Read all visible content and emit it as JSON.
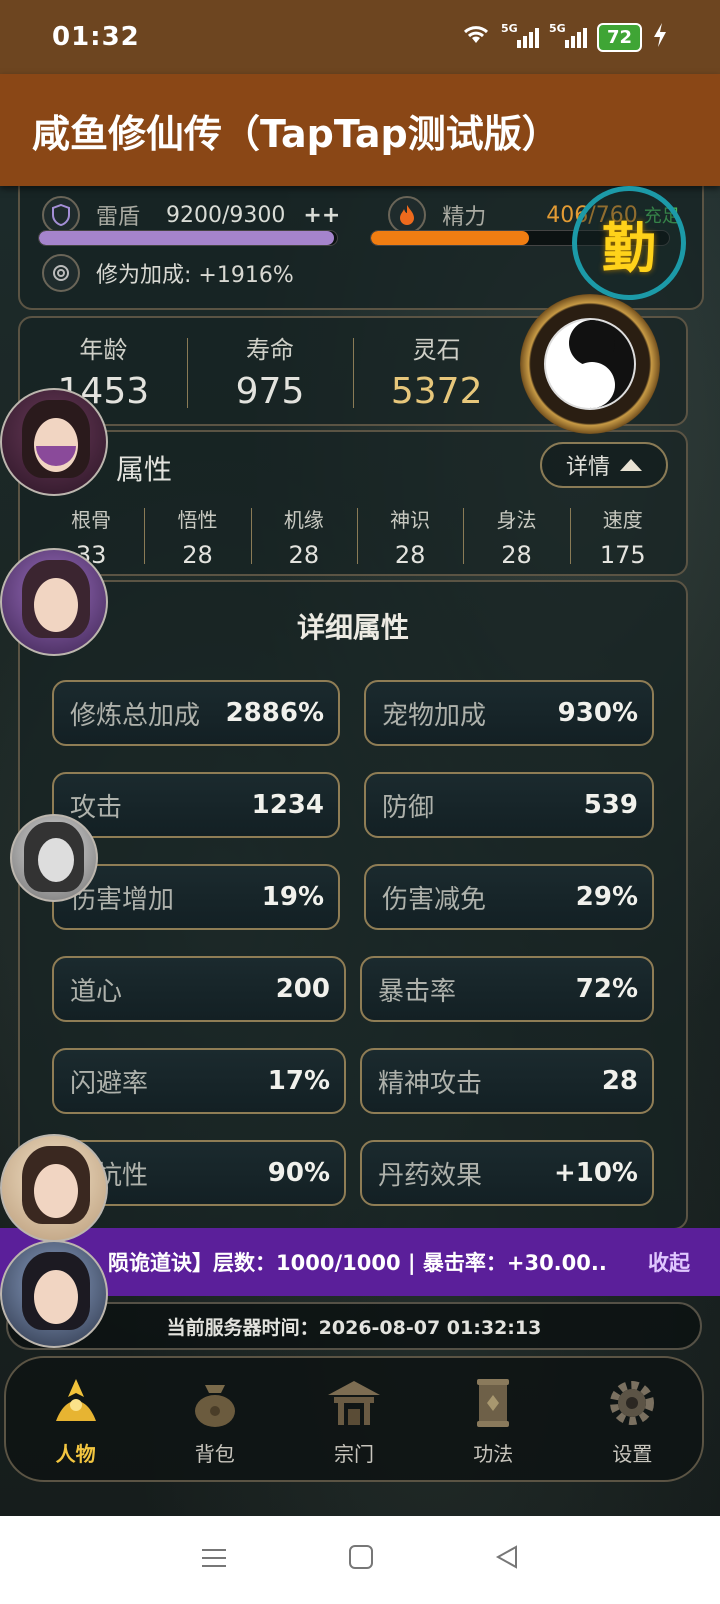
{
  "status_bar": {
    "time": "01:32",
    "battery": "72",
    "network_1": "5G",
    "network_2": "5G"
  },
  "app_title": "咸鱼修仙传（TapTap测试版）",
  "resources": {
    "shield_label": "雷盾",
    "shield_value": "9200/9300",
    "shield_plus": "++",
    "shield_fill": 0.99,
    "energy_label": "精力",
    "energy_value": "406/760",
    "energy_extra": "充足",
    "energy_fill": 0.53,
    "cultivation_bonus": "修为加成: +1916%"
  },
  "diligence_badge": "勤",
  "vitals": [
    {
      "label": "年龄",
      "value": "1453"
    },
    {
      "label": "寿命",
      "value": "975"
    },
    {
      "label": "灵石",
      "value": "5372"
    }
  ],
  "attributes": {
    "title": "属性",
    "detail_button": "详情",
    "items": [
      {
        "label": "根骨",
        "value": "33"
      },
      {
        "label": "悟性",
        "value": "28"
      },
      {
        "label": "机缘",
        "value": "28"
      },
      {
        "label": "神识",
        "value": "28"
      },
      {
        "label": "身法",
        "value": "28"
      },
      {
        "label": "速度",
        "value": "175"
      }
    ]
  },
  "detailed": {
    "title": "详细属性",
    "stats": [
      {
        "name": "修炼总加成",
        "value": "2886%"
      },
      {
        "name": "宠物加成",
        "value": "930%"
      },
      {
        "name": "攻击",
        "value": "1234"
      },
      {
        "name": "防御",
        "value": "539"
      },
      {
        "name": "伤害增加",
        "value": "19%"
      },
      {
        "name": "伤害减免",
        "value": "29%"
      },
      {
        "name": "道心",
        "value": "200"
      },
      {
        "name": "暴击率",
        "value": "72%"
      },
      {
        "name": "闪避率",
        "value": "17%"
      },
      {
        "name": "精神攻击",
        "value": "28"
      },
      {
        "name": "劫抗性",
        "value": "90%"
      },
      {
        "name": "丹药效果",
        "value": "+10%"
      }
    ]
  },
  "buff_banner": {
    "text": "陨诡道诀】层数：1000/1000 | 暴击率：+30.00...",
    "collapse": "收起"
  },
  "server_time": "当前服务器时间：2026-08-07 01:32:13",
  "nav": [
    {
      "label": "人物",
      "icon": "character-icon",
      "active": true
    },
    {
      "label": "背包",
      "icon": "bag-icon"
    },
    {
      "label": "宗门",
      "icon": "sect-icon"
    },
    {
      "label": "功法",
      "icon": "scroll-icon"
    },
    {
      "label": "设置",
      "icon": "gear-icon"
    }
  ],
  "colors": {
    "title_bar": "#8a4716",
    "accent_gold": "#f3c640",
    "buff_purple": "#5b1f9a",
    "teal_ring": "#1c9aa8"
  }
}
